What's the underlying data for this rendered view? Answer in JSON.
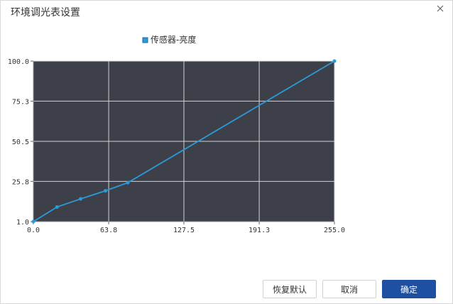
{
  "dialog": {
    "title": "环境调光表设置",
    "close_icon": "close-icon"
  },
  "buttons": {
    "restore_default": "恢复默认",
    "cancel": "取消",
    "confirm": "确定"
  },
  "colors": {
    "plot_bg": "#3d4048",
    "series": "#2a9bd8",
    "grid": "#cfd3d9",
    "primary_button": "#1f4fa0"
  },
  "chart_data": {
    "type": "line",
    "title": "",
    "legend": [
      "传感器-亮度"
    ],
    "legend_placement": "top-center",
    "xlim": [
      0,
      255
    ],
    "ylim": [
      1,
      100
    ],
    "xticks": [
      0,
      63.8,
      127.5,
      191.3,
      255
    ],
    "xtick_labels": [
      "0.0",
      "63.8",
      "127.5",
      "191.3",
      "255.0"
    ],
    "yticks": [
      1,
      25.8,
      50.5,
      75.3,
      100
    ],
    "ytick_labels": [
      "1.0",
      "25.8",
      "50.5",
      "75.3",
      "100.0"
    ],
    "grid": true,
    "series": [
      {
        "name": "传感器-亮度",
        "x": [
          0,
          20,
          40,
          61,
          80,
          255
        ],
        "y": [
          1,
          10,
          15,
          20,
          25,
          100
        ]
      }
    ]
  }
}
